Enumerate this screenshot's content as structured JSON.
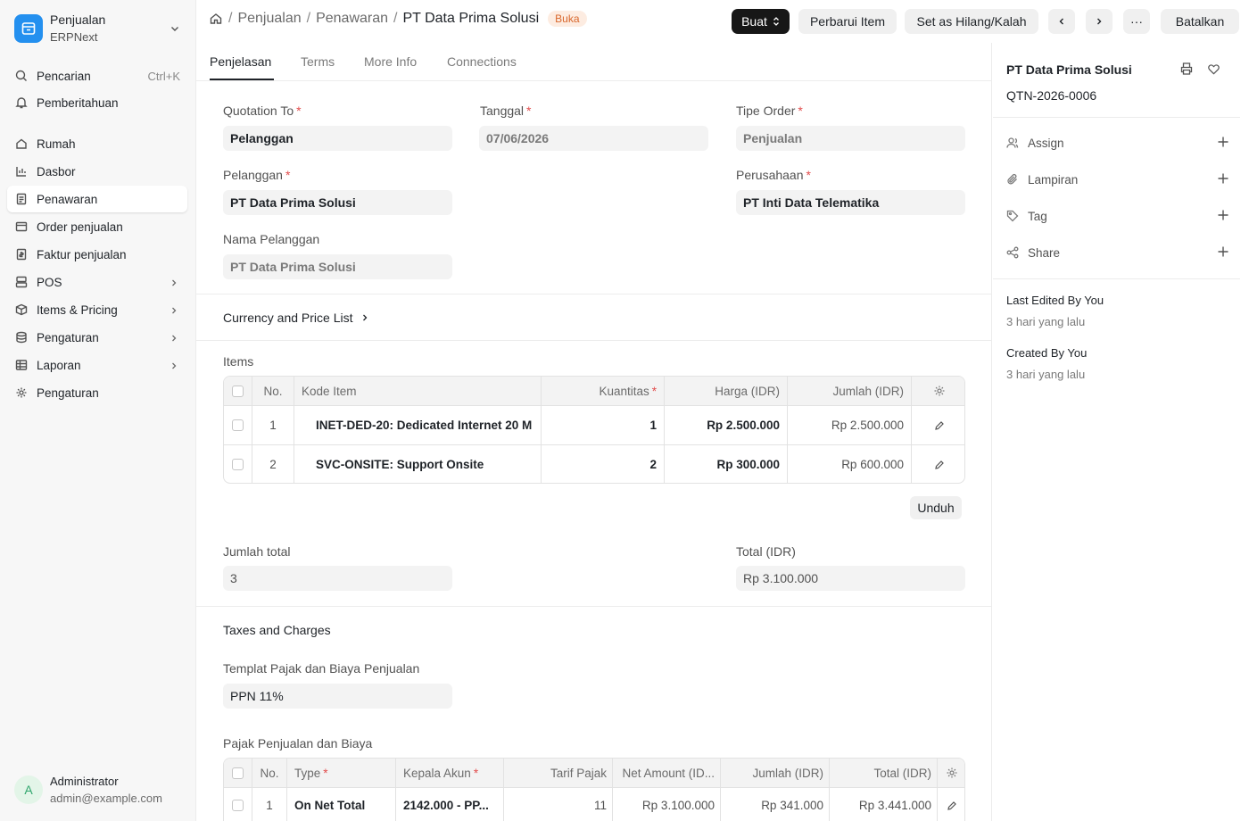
{
  "app": {
    "name": "Penjualan",
    "sub": "ERPNext"
  },
  "sidebar": {
    "search": {
      "label": "Pencarian",
      "shortcut": "Ctrl+K"
    },
    "notifications": "Pemberitahuan",
    "items": [
      {
        "label": "Rumah"
      },
      {
        "label": "Dasbor"
      },
      {
        "label": "Penawaran"
      },
      {
        "label": "Order penjualan"
      },
      {
        "label": "Faktur penjualan"
      },
      {
        "label": "POS"
      },
      {
        "label": "Items & Pricing"
      },
      {
        "label": "Pengaturan"
      },
      {
        "label": "Laporan"
      },
      {
        "label": "Pengaturan"
      }
    ],
    "active_index": 2
  },
  "user": {
    "initial": "A",
    "name": "Administrator",
    "email": "admin@example.com"
  },
  "breadcrumb": {
    "module": "Penjualan",
    "doctype": "Penawaran",
    "current": "PT Data Prima Solusi",
    "status": "Buka"
  },
  "header_buttons": {
    "create": "Buat",
    "update_items": "Perbarui Item",
    "set_lost": "Set as Hilang/Kalah",
    "more": "···",
    "cancel": "Batalkan"
  },
  "tabs": [
    "Penjelasan",
    "Terms",
    "More Info",
    "Connections"
  ],
  "form": {
    "quotation_to": {
      "label": "Quotation To",
      "value": "Pelanggan"
    },
    "date": {
      "label": "Tanggal",
      "value": "07/06/2026"
    },
    "order_type": {
      "label": "Tipe Order",
      "value": "Penjualan"
    },
    "customer": {
      "label": "Pelanggan",
      "value": "PT Data Prima Solusi"
    },
    "company": {
      "label": "Perusahaan",
      "value": "PT Inti Data Telematika"
    },
    "customer_name": {
      "label": "Nama Pelanggan",
      "value": "PT Data Prima Solusi"
    }
  },
  "currency_section": "Currency and Price List",
  "items_table": {
    "label": "Items",
    "headers": {
      "no": "No.",
      "item_code": "Kode Item",
      "qty": "Kuantitas",
      "rate": "Harga (IDR)",
      "amount": "Jumlah (IDR)"
    },
    "rows": [
      {
        "no": "1",
        "item_code": "INET-DED-20: Dedicated Internet 20 M",
        "qty": "1",
        "rate": "Rp 2.500.000",
        "amount": "Rp 2.500.000"
      },
      {
        "no": "2",
        "item_code": "SVC-ONSITE: Support Onsite",
        "qty": "2",
        "rate": "Rp 300.000",
        "amount": "Rp 600.000"
      }
    ],
    "download": "Unduh"
  },
  "totals": {
    "total_qty": {
      "label": "Jumlah total",
      "value": "3"
    },
    "total": {
      "label": "Total (IDR)",
      "value": "Rp 3.100.000"
    }
  },
  "taxes": {
    "section": "Taxes and Charges",
    "template": {
      "label": "Templat Pajak dan Biaya Penjualan",
      "value": "PPN 11%"
    },
    "table_label": "Pajak Penjualan dan Biaya",
    "headers": {
      "no": "No.",
      "type": "Type",
      "account": "Kepala Akun",
      "rate": "Tarif Pajak",
      "net": "Net Amount (ID...",
      "amount": "Jumlah (IDR)",
      "total": "Total (IDR)"
    },
    "rows": [
      {
        "no": "1",
        "type": "On Net Total",
        "account": "2142.000 - PP...",
        "rate": "11",
        "net": "Rp 3.100.000",
        "amount": "Rp 341.000",
        "total": "Rp 3.441.000"
      }
    ]
  },
  "right_panel": {
    "title": "PT Data Prima Solusi",
    "name": "QTN-2026-0006",
    "actions": [
      "Assign",
      "Lampiran",
      "Tag",
      "Share"
    ],
    "last_edited": "Last Edited By You",
    "last_edited_time": "3 hari yang lalu",
    "created": "Created By You",
    "created_time": "3 hari yang lalu"
  }
}
